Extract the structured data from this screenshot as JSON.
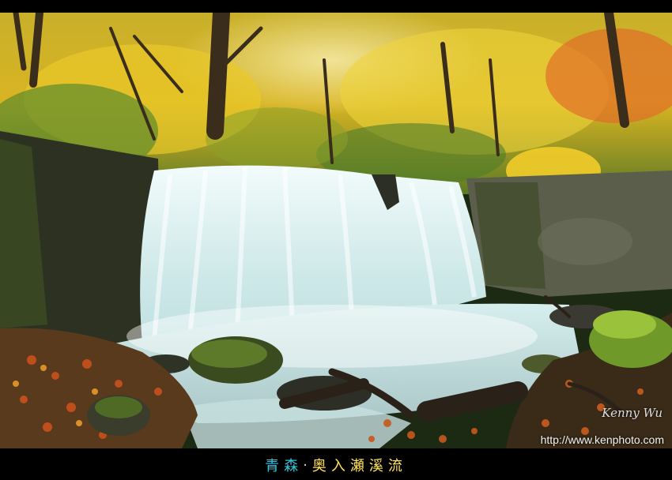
{
  "photo": {
    "subject": "autumn-forest-waterfall",
    "palette": {
      "foliage_yellow": "#e8c21f",
      "foliage_orange": "#e07a1e",
      "foliage_green": "#5f8f2a",
      "water": "#dcefee",
      "rock": "#2f3325",
      "moss": "#4b6b25"
    },
    "watermark_signature": "Kenny Wu",
    "watermark_url": "http://www.kenphoto.com"
  },
  "caption": {
    "text": "青森 · 奥入瀬溪流",
    "chars": [
      "青",
      "森",
      "·",
      "奥",
      "入",
      "瀬",
      "溪",
      "流"
    ],
    "colors": [
      "#33c6e0",
      "#33c6e0",
      "#cccccc",
      "#ffe45c",
      "#ffe45c",
      "#ffe45c",
      "#ffe45c",
      "#ffe45c"
    ]
  }
}
